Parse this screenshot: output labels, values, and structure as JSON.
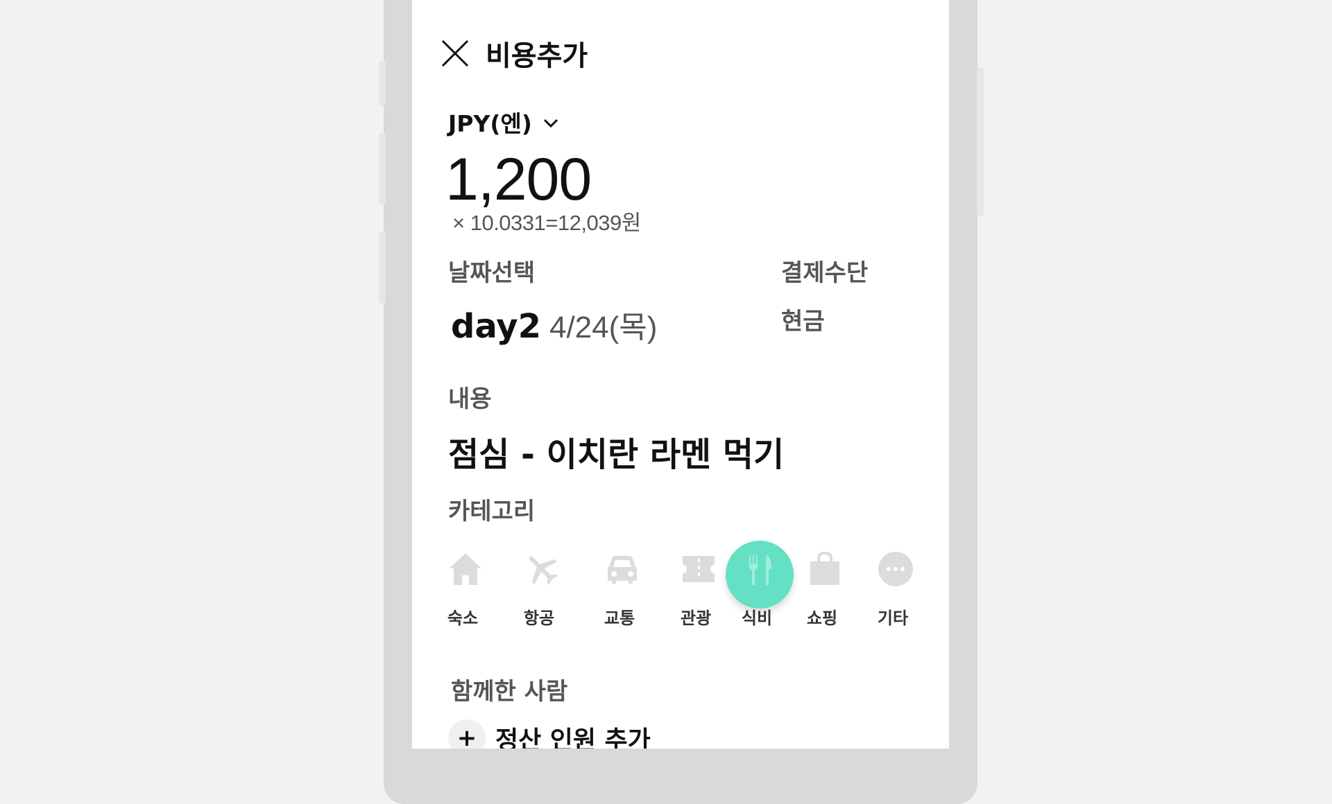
{
  "header": {
    "title": "비용추가",
    "close_icon": "close-icon"
  },
  "currency": {
    "label": "JPY(엔)",
    "dropdown_icon": "chevron-down-icon"
  },
  "amount": {
    "value": "1,200",
    "conversion": "× 10.0331=12,039원"
  },
  "date": {
    "label": "날짜선택",
    "day": "day2",
    "date": "4/24(목)"
  },
  "payment": {
    "label": "결제수단",
    "value": "현금"
  },
  "content": {
    "label": "내용",
    "value": "점심 - 이치란 라멘 먹기"
  },
  "category": {
    "label": "카테고리",
    "selected": "식비",
    "selected_color": "#64e0c4",
    "items": [
      {
        "label": "숙소",
        "icon": "home-icon"
      },
      {
        "label": "항공",
        "icon": "airplane-icon"
      },
      {
        "label": "교통",
        "icon": "car-icon"
      },
      {
        "label": "관광",
        "icon": "ticket-icon"
      },
      {
        "label": "식비",
        "icon": "utensils-icon"
      },
      {
        "label": "쇼핑",
        "icon": "shopping-bag-icon"
      },
      {
        "label": "기타",
        "icon": "more-icon"
      }
    ]
  },
  "companions": {
    "label": "함께한 사람",
    "add_label": "정산 인원 추가",
    "add_icon": "plus-icon"
  }
}
